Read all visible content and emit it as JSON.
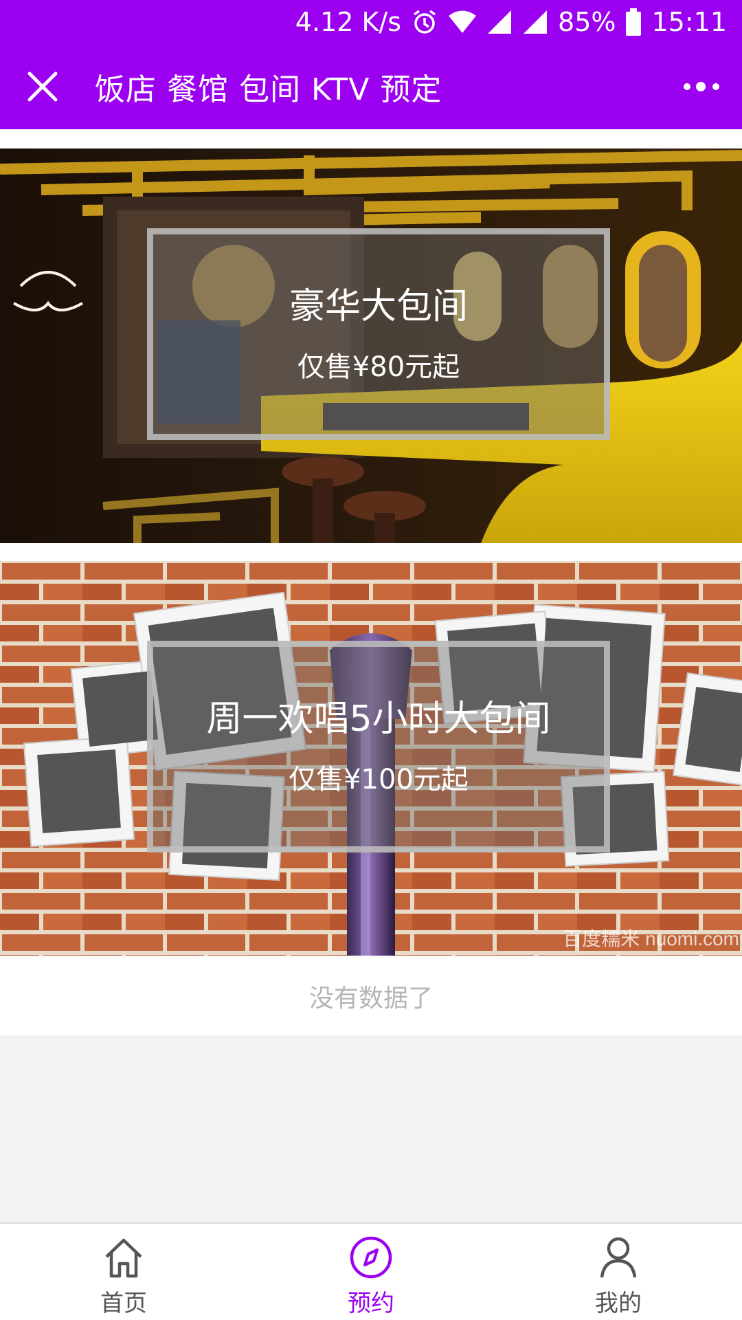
{
  "status_bar": {
    "network_speed": "4.12 K/s",
    "battery": "85%",
    "time": "15:11",
    "icons": [
      "alarm-icon",
      "wifi-icon",
      "signal-icon",
      "signal-icon",
      "battery-icon"
    ]
  },
  "title_bar": {
    "title": "饭店 餐馆 包间 KTV 预定",
    "close_icon": "close-icon",
    "more_icon": "more-icon"
  },
  "banners": [
    {
      "title": "豪华大包间",
      "price": "仅售¥80元起"
    },
    {
      "title": "周一欢唱5小时大包间",
      "price": "仅售¥100元起",
      "watermark": "百度糯米 nuomi.com"
    }
  ],
  "list_end_text": "没有数据了",
  "tabs": [
    {
      "label": "首页",
      "icon": "home-icon",
      "active": false
    },
    {
      "label": "预约",
      "icon": "compass-icon",
      "active": true
    },
    {
      "label": "我的",
      "icon": "user-icon",
      "active": false
    }
  ],
  "colors": {
    "accent": "#9b00f0",
    "tab_inactive": "#555555",
    "muted_text": "#b5b5b5"
  }
}
